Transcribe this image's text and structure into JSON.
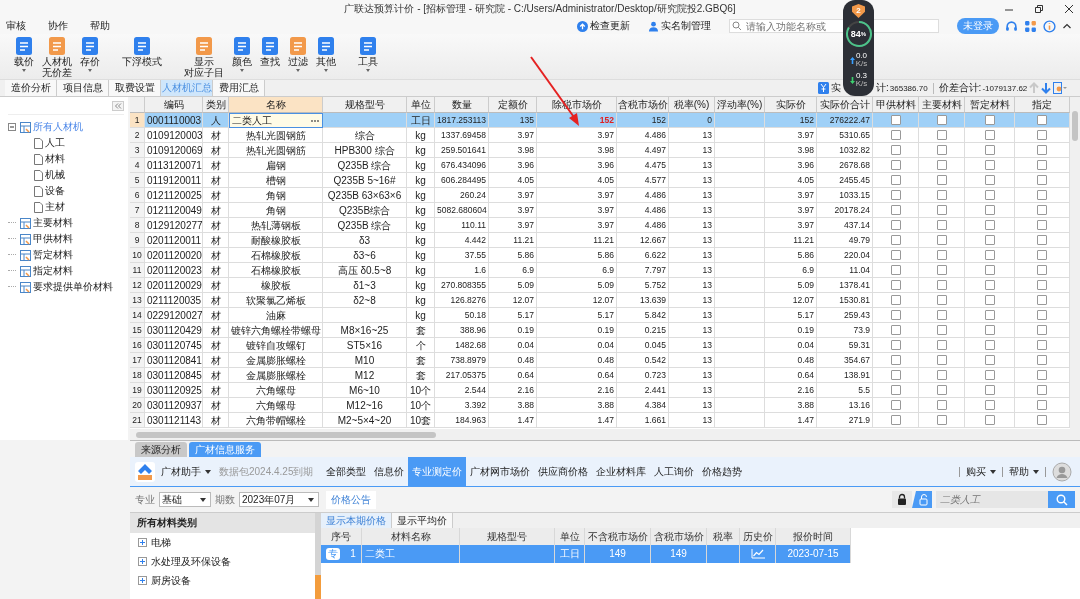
{
  "window": {
    "title": "广联达预算计价 - [招标管理 - 研究院 - C:/Users/Administrator/Desktop/研究院投2.GBQ6]"
  },
  "menu": [
    "审核",
    "协作",
    "帮助"
  ],
  "header_actions": {
    "update": "检查更新",
    "realname": "实名制管理",
    "search": {
      "placeholder": "请输入功能名称或"
    },
    "login": "未登录"
  },
  "monitor": {
    "badge": "2",
    "percent": "84",
    "percent_unit": "%",
    "level": 0.84,
    "up": {
      "value": "0.0",
      "unit": "K/s"
    },
    "down": {
      "value": "0.3",
      "unit": "K/s"
    }
  },
  "toolbar": [
    {
      "lines": [
        "载价"
      ],
      "dropdown": true
    },
    {
      "lines": [
        "人材机",
        "无价差"
      ],
      "dropdown": false
    },
    {
      "lines": [
        "存价"
      ],
      "dropdown": true
    },
    {
      "lines": [
        "下浮模式"
      ],
      "dropdown": false
    },
    {
      "lines": [
        "显示",
        "对应子目"
      ],
      "dropdown": false
    },
    {
      "lines": [
        "颜色"
      ],
      "dropdown": true
    },
    {
      "lines": [
        "查找"
      ],
      "dropdown": false
    },
    {
      "lines": [
        "过滤"
      ],
      "dropdown": true
    },
    {
      "lines": [
        "其他"
      ],
      "dropdown": true
    },
    {
      "lines": [
        "工具"
      ],
      "dropdown": true
    }
  ],
  "tabs": [
    {
      "label": "造价分析",
      "selected": false
    },
    {
      "label": "项目信息",
      "selected": false
    },
    {
      "label": "取费设置",
      "selected": false
    },
    {
      "label": "人材机汇总",
      "selected": true
    },
    {
      "label": "费用汇总",
      "selected": false
    }
  ],
  "summary": {
    "actual_head": "实",
    "actual_tail": "计:",
    "actual_value": "365386.70",
    "diff_label": "价差合计:",
    "diff_value": "-1079137.62"
  },
  "tree": [
    {
      "label": "所有人材机",
      "selected": true,
      "expanded": true,
      "children": [
        {
          "label": "人工"
        },
        {
          "label": "材料"
        },
        {
          "label": "机械"
        },
        {
          "label": "设备"
        },
        {
          "label": "主材"
        }
      ]
    },
    {
      "label": "主要材料",
      "selected": false
    },
    {
      "label": "甲供材料",
      "selected": false
    },
    {
      "label": "暂定材料",
      "selected": false
    },
    {
      "label": "指定材料",
      "selected": false
    },
    {
      "label": "要求提供单价材料",
      "selected": false
    }
  ],
  "table": {
    "columns": [
      "编码",
      "类别",
      "名称",
      "规格型号",
      "单位",
      "数量",
      "定额价",
      "除税市场价",
      "含税市场价",
      "税率(%)",
      "浮动率(%)",
      "实际价",
      "实际价合计",
      "甲供材料",
      "主要材料",
      "暂定材料",
      "指定"
    ],
    "rows": [
      {
        "no": "1",
        "selected": true,
        "editing": true,
        "changed": true,
        "code": "0001110003",
        "type": "人",
        "name": "二类人工",
        "unit": "工日",
        "qty": "1817.253113",
        "quota": "135",
        "market": "152",
        "taxed": "152",
        "rate": "0",
        "actual": "152",
        "total": "276222.47",
        "checks": [
          false,
          false,
          false,
          false
        ]
      },
      {
        "no": "2",
        "selected": false,
        "editing": false,
        "changed": false,
        "code": "0109120003",
        "type": "材",
        "name": "热轧光圆钢筋",
        "spec": "综合",
        "unit": "kg",
        "qty": "1337.69458",
        "quota": "3.97",
        "market": "3.97",
        "taxed": "4.486",
        "rate": "13",
        "actual": "3.97",
        "total": "5310.65",
        "checks": [
          false,
          false,
          false,
          false
        ]
      },
      {
        "no": "3",
        "selected": false,
        "editing": false,
        "changed": false,
        "code": "0109120069",
        "type": "材",
        "name": "热轧光圆钢筋",
        "spec": "HPB300 综合",
        "unit": "kg",
        "qty": "259.501641",
        "quota": "3.98",
        "market": "3.98",
        "taxed": "4.497",
        "rate": "13",
        "actual": "3.98",
        "total": "1032.82",
        "checks": [
          false,
          false,
          false,
          false
        ]
      },
      {
        "no": "4",
        "selected": false,
        "editing": false,
        "changed": false,
        "code": "0113120071",
        "type": "材",
        "name": "扁钢",
        "spec": "Q235B 综合",
        "unit": "kg",
        "qty": "676.434096",
        "quota": "3.96",
        "market": "3.96",
        "taxed": "4.475",
        "rate": "13",
        "actual": "3.96",
        "total": "2678.68",
        "checks": [
          false,
          false,
          false,
          false
        ]
      },
      {
        "no": "5",
        "selected": false,
        "editing": false,
        "changed": false,
        "code": "0119120011",
        "type": "材",
        "name": "槽钢",
        "spec": "Q235B 5~16#",
        "unit": "kg",
        "qty": "606.284495",
        "quota": "4.05",
        "market": "4.05",
        "taxed": "4.577",
        "rate": "13",
        "actual": "4.05",
        "total": "2455.45",
        "checks": [
          false,
          false,
          false,
          false
        ]
      },
      {
        "no": "6",
        "selected": false,
        "editing": false,
        "changed": false,
        "code": "0121120025",
        "type": "材",
        "name": "角钢",
        "spec": "Q235B 63×63×6",
        "unit": "kg",
        "qty": "260.24",
        "quota": "3.97",
        "market": "3.97",
        "taxed": "4.486",
        "rate": "13",
        "actual": "3.97",
        "total": "1033.15",
        "checks": [
          false,
          false,
          false,
          false
        ]
      },
      {
        "no": "7",
        "selected": false,
        "editing": false,
        "changed": false,
        "code": "0121120049",
        "type": "材",
        "name": "角钢",
        "spec": "Q235B综合",
        "unit": "kg",
        "qty": "5082.680604",
        "quota": "3.97",
        "market": "3.97",
        "taxed": "4.486",
        "rate": "13",
        "actual": "3.97",
        "total": "20178.24",
        "checks": [
          false,
          false,
          false,
          false
        ]
      },
      {
        "no": "8",
        "selected": false,
        "editing": false,
        "changed": false,
        "code": "0129120277",
        "type": "材",
        "name": "热轧薄钢板",
        "spec": "Q235B 综合",
        "unit": "kg",
        "qty": "110.11",
        "quota": "3.97",
        "market": "3.97",
        "taxed": "4.486",
        "rate": "13",
        "actual": "3.97",
        "total": "437.14",
        "checks": [
          false,
          false,
          false,
          false
        ]
      },
      {
        "no": "9",
        "selected": false,
        "editing": false,
        "changed": false,
        "code": "0201120011",
        "type": "材",
        "name": "耐酸橡胶板",
        "spec": "δ3",
        "unit": "kg",
        "qty": "4.442",
        "quota": "11.21",
        "market": "11.21",
        "taxed": "12.667",
        "rate": "13",
        "actual": "11.21",
        "total": "49.79",
        "checks": [
          false,
          false,
          false,
          false
        ]
      },
      {
        "no": "10",
        "selected": false,
        "editing": false,
        "changed": false,
        "code": "0201120020",
        "type": "材",
        "name": "石棉橡胶板",
        "spec": "δ3~6",
        "unit": "kg",
        "qty": "37.55",
        "quota": "5.86",
        "market": "5.86",
        "taxed": "6.622",
        "rate": "13",
        "actual": "5.86",
        "total": "220.04",
        "checks": [
          false,
          false,
          false,
          false
        ]
      },
      {
        "no": "11",
        "selected": false,
        "editing": false,
        "changed": false,
        "code": "0201120023",
        "type": "材",
        "name": "石棉橡胶板",
        "spec": "高压 δ0.5~8",
        "unit": "kg",
        "qty": "1.6",
        "quota": "6.9",
        "market": "6.9",
        "taxed": "7.797",
        "rate": "13",
        "actual": "6.9",
        "total": "11.04",
        "checks": [
          false,
          false,
          false,
          false
        ]
      },
      {
        "no": "12",
        "selected": false,
        "editing": false,
        "changed": false,
        "code": "0201120029",
        "type": "材",
        "name": "橡胶板",
        "spec": "δ1~3",
        "unit": "kg",
        "qty": "270.808355",
        "quota": "5.09",
        "market": "5.09",
        "taxed": "5.752",
        "rate": "13",
        "actual": "5.09",
        "total": "1378.41",
        "checks": [
          false,
          false,
          false,
          false
        ]
      },
      {
        "no": "13",
        "selected": false,
        "editing": false,
        "changed": false,
        "code": "0211120035",
        "type": "材",
        "name": "软聚氯乙烯板",
        "spec": "δ2~8",
        "unit": "kg",
        "qty": "126.8276",
        "quota": "12.07",
        "market": "12.07",
        "taxed": "13.639",
        "rate": "13",
        "actual": "12.07",
        "total": "1530.81",
        "checks": [
          false,
          false,
          false,
          false
        ]
      },
      {
        "no": "14",
        "selected": false,
        "editing": false,
        "changed": false,
        "code": "0229120027",
        "type": "材",
        "name": "油麻",
        "unit": "kg",
        "qty": "50.18",
        "quota": "5.17",
        "market": "5.17",
        "taxed": "5.842",
        "rate": "13",
        "actual": "5.17",
        "total": "259.43",
        "checks": [
          false,
          false,
          false,
          false
        ]
      },
      {
        "no": "15",
        "selected": false,
        "editing": false,
        "changed": false,
        "code": "0301120429",
        "type": "材",
        "name": "镀锌六角螺栓带螺母",
        "spec": "M8×16~25",
        "unit": "套",
        "qty": "388.96",
        "quota": "0.19",
        "market": "0.19",
        "taxed": "0.215",
        "rate": "13",
        "actual": "0.19",
        "total": "73.9",
        "checks": [
          false,
          false,
          false,
          false
        ]
      },
      {
        "no": "16",
        "selected": false,
        "editing": false,
        "changed": false,
        "code": "0301120745",
        "type": "材",
        "name": "镀锌自攻螺钉",
        "spec": "ST5×16",
        "unit": "个",
        "qty": "1482.68",
        "quota": "0.04",
        "market": "0.04",
        "taxed": "0.045",
        "rate": "13",
        "actual": "0.04",
        "total": "59.31",
        "checks": [
          false,
          false,
          false,
          false
        ]
      },
      {
        "no": "17",
        "selected": false,
        "editing": false,
        "changed": false,
        "code": "0301120841",
        "type": "材",
        "name": "金属膨胀螺栓",
        "spec": "M10",
        "unit": "套",
        "qty": "738.8979",
        "quota": "0.48",
        "market": "0.48",
        "taxed": "0.542",
        "rate": "13",
        "actual": "0.48",
        "total": "354.67",
        "checks": [
          false,
          false,
          false,
          false
        ]
      },
      {
        "no": "18",
        "selected": false,
        "editing": false,
        "changed": false,
        "code": "0301120845",
        "type": "材",
        "name": "金属膨胀螺栓",
        "spec": "M12",
        "unit": "套",
        "qty": "217.05375",
        "quota": "0.64",
        "market": "0.64",
        "taxed": "0.723",
        "rate": "13",
        "actual": "0.64",
        "total": "138.91",
        "checks": [
          false,
          false,
          false,
          false
        ]
      },
      {
        "no": "19",
        "selected": false,
        "editing": false,
        "changed": false,
        "code": "0301120925",
        "type": "材",
        "name": "六角螺母",
        "spec": "M6~10",
        "unit": "10个",
        "qty": "2.544",
        "quota": "2.16",
        "market": "2.16",
        "taxed": "2.441",
        "rate": "13",
        "actual": "2.16",
        "total": "5.5",
        "checks": [
          false,
          false,
          false,
          false
        ]
      },
      {
        "no": "20",
        "selected": false,
        "editing": false,
        "changed": false,
        "code": "0301120937",
        "type": "材",
        "name": "六角螺母",
        "spec": "M12~16",
        "unit": "10个",
        "qty": "3.392",
        "quota": "3.88",
        "market": "3.88",
        "taxed": "4.384",
        "rate": "13",
        "actual": "3.88",
        "total": "13.16",
        "checks": [
          false,
          false,
          false,
          false
        ]
      },
      {
        "no": "21",
        "selected": false,
        "editing": false,
        "changed": false,
        "code": "0301121143",
        "type": "材",
        "name": "六角带帽螺栓",
        "spec": "M2~5×4~20",
        "unit": "10套",
        "qty": "184.963",
        "quota": "1.47",
        "market": "1.47",
        "taxed": "1.661",
        "rate": "13",
        "actual": "1.47",
        "total": "271.9",
        "checks": [
          false,
          false,
          false,
          false
        ]
      }
    ]
  },
  "bottom_tabs": [
    {
      "label": "来源分析",
      "selected": false
    },
    {
      "label": "广材信息服务",
      "selected": true
    }
  ],
  "assistant": {
    "name": "广材助手",
    "expiry": "数据包2024.4.25到期",
    "buy": "购买",
    "help": "帮助",
    "nav": [
      {
        "label": "全部类型",
        "selected": false
      },
      {
        "label": "信息价",
        "selected": false
      },
      {
        "label": "专业测定价",
        "selected": true
      },
      {
        "label": "广材网市场价",
        "selected": false
      },
      {
        "label": "供应商价格",
        "selected": false
      },
      {
        "label": "企业材料库",
        "selected": false
      },
      {
        "label": "人工询价",
        "selected": false
      },
      {
        "label": "价格趋势",
        "selected": false
      }
    ]
  },
  "filters": {
    "major_label": "专业",
    "major": "基础",
    "period_label": "期数",
    "period": "2023年07月",
    "notice": "价格公告",
    "search": {
      "placeholder": "二类人工"
    }
  },
  "categories": {
    "title": "所有材料类别",
    "items": [
      "电梯",
      "水处理及环保设备",
      "厨房设备"
    ]
  },
  "price_tabs": [
    {
      "label": "显示本期价格",
      "selected": true
    },
    {
      "label": "显示平均价",
      "selected": false
    }
  ],
  "price_table": {
    "columns": [
      "序号",
      "材料名称",
      "规格型号",
      "单位",
      "不含税市场价",
      "含税市场价",
      "税率",
      "历史价",
      "报价时间"
    ],
    "rows": [
      {
        "badge": "专",
        "no": "1",
        "name": "二类工",
        "unit": "工日",
        "price": "149",
        "taxed": "149",
        "date": "2023-07-15",
        "selected": true
      }
    ]
  }
}
